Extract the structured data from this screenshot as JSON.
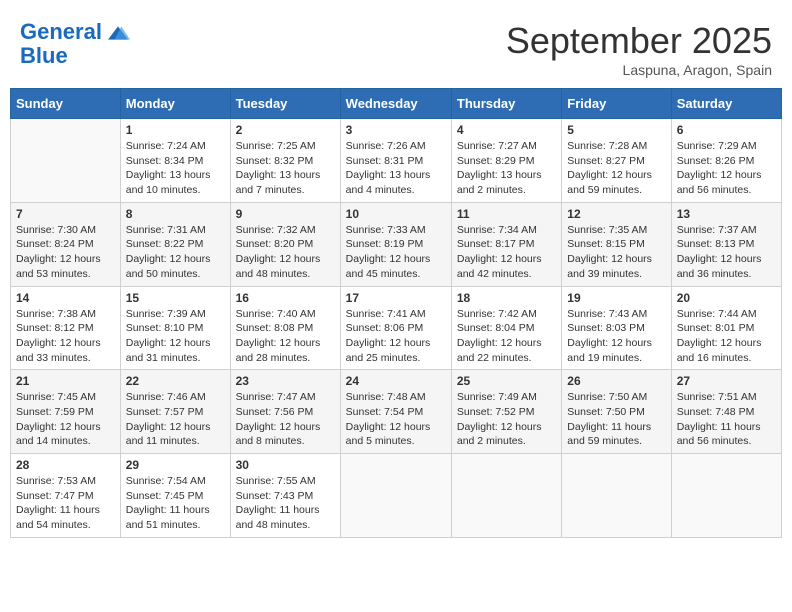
{
  "header": {
    "logo_line1": "General",
    "logo_line2": "Blue",
    "month_title": "September 2025",
    "location": "Laspuna, Aragon, Spain"
  },
  "calendar": {
    "days_of_week": [
      "Sunday",
      "Monday",
      "Tuesday",
      "Wednesday",
      "Thursday",
      "Friday",
      "Saturday"
    ],
    "weeks": [
      [
        {
          "day": "",
          "info": ""
        },
        {
          "day": "1",
          "info": "Sunrise: 7:24 AM\nSunset: 8:34 PM\nDaylight: 13 hours and 10 minutes."
        },
        {
          "day": "2",
          "info": "Sunrise: 7:25 AM\nSunset: 8:32 PM\nDaylight: 13 hours and 7 minutes."
        },
        {
          "day": "3",
          "info": "Sunrise: 7:26 AM\nSunset: 8:31 PM\nDaylight: 13 hours and 4 minutes."
        },
        {
          "day": "4",
          "info": "Sunrise: 7:27 AM\nSunset: 8:29 PM\nDaylight: 13 hours and 2 minutes."
        },
        {
          "day": "5",
          "info": "Sunrise: 7:28 AM\nSunset: 8:27 PM\nDaylight: 12 hours and 59 minutes."
        },
        {
          "day": "6",
          "info": "Sunrise: 7:29 AM\nSunset: 8:26 PM\nDaylight: 12 hours and 56 minutes."
        }
      ],
      [
        {
          "day": "7",
          "info": "Sunrise: 7:30 AM\nSunset: 8:24 PM\nDaylight: 12 hours and 53 minutes."
        },
        {
          "day": "8",
          "info": "Sunrise: 7:31 AM\nSunset: 8:22 PM\nDaylight: 12 hours and 50 minutes."
        },
        {
          "day": "9",
          "info": "Sunrise: 7:32 AM\nSunset: 8:20 PM\nDaylight: 12 hours and 48 minutes."
        },
        {
          "day": "10",
          "info": "Sunrise: 7:33 AM\nSunset: 8:19 PM\nDaylight: 12 hours and 45 minutes."
        },
        {
          "day": "11",
          "info": "Sunrise: 7:34 AM\nSunset: 8:17 PM\nDaylight: 12 hours and 42 minutes."
        },
        {
          "day": "12",
          "info": "Sunrise: 7:35 AM\nSunset: 8:15 PM\nDaylight: 12 hours and 39 minutes."
        },
        {
          "day": "13",
          "info": "Sunrise: 7:37 AM\nSunset: 8:13 PM\nDaylight: 12 hours and 36 minutes."
        }
      ],
      [
        {
          "day": "14",
          "info": "Sunrise: 7:38 AM\nSunset: 8:12 PM\nDaylight: 12 hours and 33 minutes."
        },
        {
          "day": "15",
          "info": "Sunrise: 7:39 AM\nSunset: 8:10 PM\nDaylight: 12 hours and 31 minutes."
        },
        {
          "day": "16",
          "info": "Sunrise: 7:40 AM\nSunset: 8:08 PM\nDaylight: 12 hours and 28 minutes."
        },
        {
          "day": "17",
          "info": "Sunrise: 7:41 AM\nSunset: 8:06 PM\nDaylight: 12 hours and 25 minutes."
        },
        {
          "day": "18",
          "info": "Sunrise: 7:42 AM\nSunset: 8:04 PM\nDaylight: 12 hours and 22 minutes."
        },
        {
          "day": "19",
          "info": "Sunrise: 7:43 AM\nSunset: 8:03 PM\nDaylight: 12 hours and 19 minutes."
        },
        {
          "day": "20",
          "info": "Sunrise: 7:44 AM\nSunset: 8:01 PM\nDaylight: 12 hours and 16 minutes."
        }
      ],
      [
        {
          "day": "21",
          "info": "Sunrise: 7:45 AM\nSunset: 7:59 PM\nDaylight: 12 hours and 14 minutes."
        },
        {
          "day": "22",
          "info": "Sunrise: 7:46 AM\nSunset: 7:57 PM\nDaylight: 12 hours and 11 minutes."
        },
        {
          "day": "23",
          "info": "Sunrise: 7:47 AM\nSunset: 7:56 PM\nDaylight: 12 hours and 8 minutes."
        },
        {
          "day": "24",
          "info": "Sunrise: 7:48 AM\nSunset: 7:54 PM\nDaylight: 12 hours and 5 minutes."
        },
        {
          "day": "25",
          "info": "Sunrise: 7:49 AM\nSunset: 7:52 PM\nDaylight: 12 hours and 2 minutes."
        },
        {
          "day": "26",
          "info": "Sunrise: 7:50 AM\nSunset: 7:50 PM\nDaylight: 11 hours and 59 minutes."
        },
        {
          "day": "27",
          "info": "Sunrise: 7:51 AM\nSunset: 7:48 PM\nDaylight: 11 hours and 56 minutes."
        }
      ],
      [
        {
          "day": "28",
          "info": "Sunrise: 7:53 AM\nSunset: 7:47 PM\nDaylight: 11 hours and 54 minutes."
        },
        {
          "day": "29",
          "info": "Sunrise: 7:54 AM\nSunset: 7:45 PM\nDaylight: 11 hours and 51 minutes."
        },
        {
          "day": "30",
          "info": "Sunrise: 7:55 AM\nSunset: 7:43 PM\nDaylight: 11 hours and 48 minutes."
        },
        {
          "day": "",
          "info": ""
        },
        {
          "day": "",
          "info": ""
        },
        {
          "day": "",
          "info": ""
        },
        {
          "day": "",
          "info": ""
        }
      ]
    ]
  }
}
